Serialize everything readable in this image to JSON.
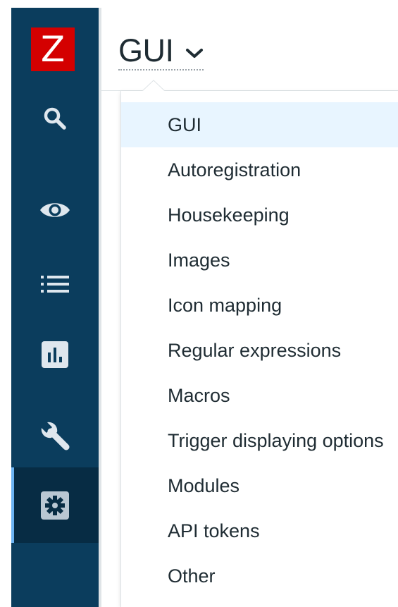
{
  "logo": {
    "letter": "Z",
    "color": "#d40000"
  },
  "sidebar": {
    "background": "#0b3d5d",
    "items": [
      {
        "icon": "search-icon"
      },
      {
        "icon": "eye-icon"
      },
      {
        "icon": "list-icon"
      },
      {
        "icon": "bar-chart-icon"
      },
      {
        "icon": "wrench-icon"
      },
      {
        "icon": "gear-icon",
        "active": true
      }
    ]
  },
  "header": {
    "title": "GUI",
    "title_icon": "chevron-down-icon"
  },
  "dropdown": {
    "selected": "GUI",
    "items": [
      {
        "label": "GUI"
      },
      {
        "label": "Autoregistration"
      },
      {
        "label": "Housekeeping"
      },
      {
        "label": "Images"
      },
      {
        "label": "Icon mapping"
      },
      {
        "label": "Regular expressions"
      },
      {
        "label": "Macros"
      },
      {
        "label": "Trigger displaying options"
      },
      {
        "label": "Modules"
      },
      {
        "label": "API tokens"
      },
      {
        "label": "Other"
      }
    ]
  }
}
